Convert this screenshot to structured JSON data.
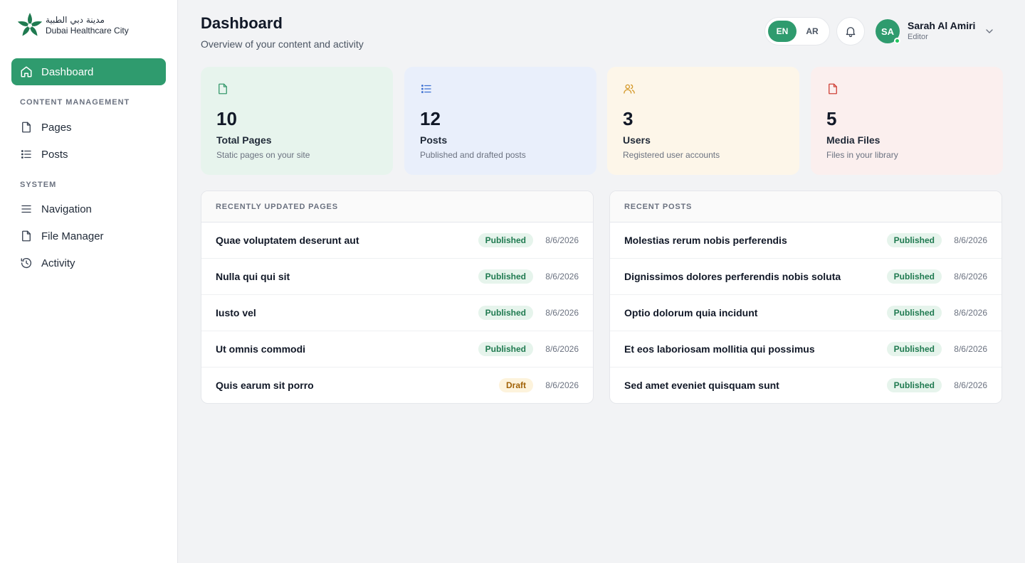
{
  "brand": {
    "name_ar": "مدينة دبي الطبية",
    "name_en": "Dubai Healthcare City",
    "color": "#2f9b6e"
  },
  "sidebar": {
    "active": {
      "label": "Dashboard",
      "icon": "home-icon"
    },
    "sections": [
      {
        "label": "CONTENT MANAGEMENT",
        "items": [
          {
            "label": "Pages",
            "icon": "file-icon"
          },
          {
            "label": "Posts",
            "icon": "list-icon"
          }
        ]
      },
      {
        "label": "SYSTEM",
        "items": [
          {
            "label": "Navigation",
            "icon": "menu-icon"
          },
          {
            "label": "File Manager",
            "icon": "file-icon"
          },
          {
            "label": "Activity",
            "icon": "history-icon"
          }
        ]
      }
    ]
  },
  "header": {
    "title": "Dashboard",
    "subtitle": "Overview of your content and activity",
    "lang": {
      "en": "EN",
      "ar": "AR",
      "selected": "EN"
    },
    "user": {
      "initials": "SA",
      "name": "Sarah Al Amiri",
      "role": "Editor"
    }
  },
  "stats": [
    {
      "value": "10",
      "label": "Total Pages",
      "desc": "Static pages on your site",
      "icon": "file-icon",
      "bg": "#e7f4ed",
      "accent": "#3a9b6f"
    },
    {
      "value": "12",
      "label": "Posts",
      "desc": "Published and drafted posts",
      "icon": "list-icon",
      "bg": "#e9effb",
      "accent": "#3b6fd1"
    },
    {
      "value": "3",
      "label": "Users",
      "desc": "Registered user accounts",
      "icon": "users-icon",
      "bg": "#fdf6e9",
      "accent": "#d59a2c"
    },
    {
      "value": "5",
      "label": "Media Files",
      "desc": "Files in your library",
      "icon": "file-icon",
      "bg": "#fbefee",
      "accent": "#d0443a"
    }
  ],
  "recent_pages": {
    "title": "RECENTLY UPDATED PAGES",
    "rows": [
      {
        "title": "Quae voluptatem deserunt aut",
        "status": "Published",
        "date": "8/6/2026"
      },
      {
        "title": "Nulla qui qui sit",
        "status": "Published",
        "date": "8/6/2026"
      },
      {
        "title": "Iusto vel",
        "status": "Published",
        "date": "8/6/2026"
      },
      {
        "title": "Ut omnis commodi",
        "status": "Published",
        "date": "8/6/2026"
      },
      {
        "title": "Quis earum sit porro",
        "status": "Draft",
        "date": "8/6/2026"
      }
    ]
  },
  "recent_posts": {
    "title": "RECENT POSTS",
    "rows": [
      {
        "title": "Molestias rerum nobis perferendis",
        "status": "Published",
        "date": "8/6/2026"
      },
      {
        "title": "Dignissimos dolores perferendis nobis soluta",
        "status": "Published",
        "date": "8/6/2026"
      },
      {
        "title": "Optio dolorum quia incidunt",
        "status": "Published",
        "date": "8/6/2026"
      },
      {
        "title": "Et eos laboriosam mollitia qui possimus",
        "status": "Published",
        "date": "8/6/2026"
      },
      {
        "title": "Sed amet eveniet quisquam sunt",
        "status": "Published",
        "date": "8/6/2026"
      }
    ]
  }
}
